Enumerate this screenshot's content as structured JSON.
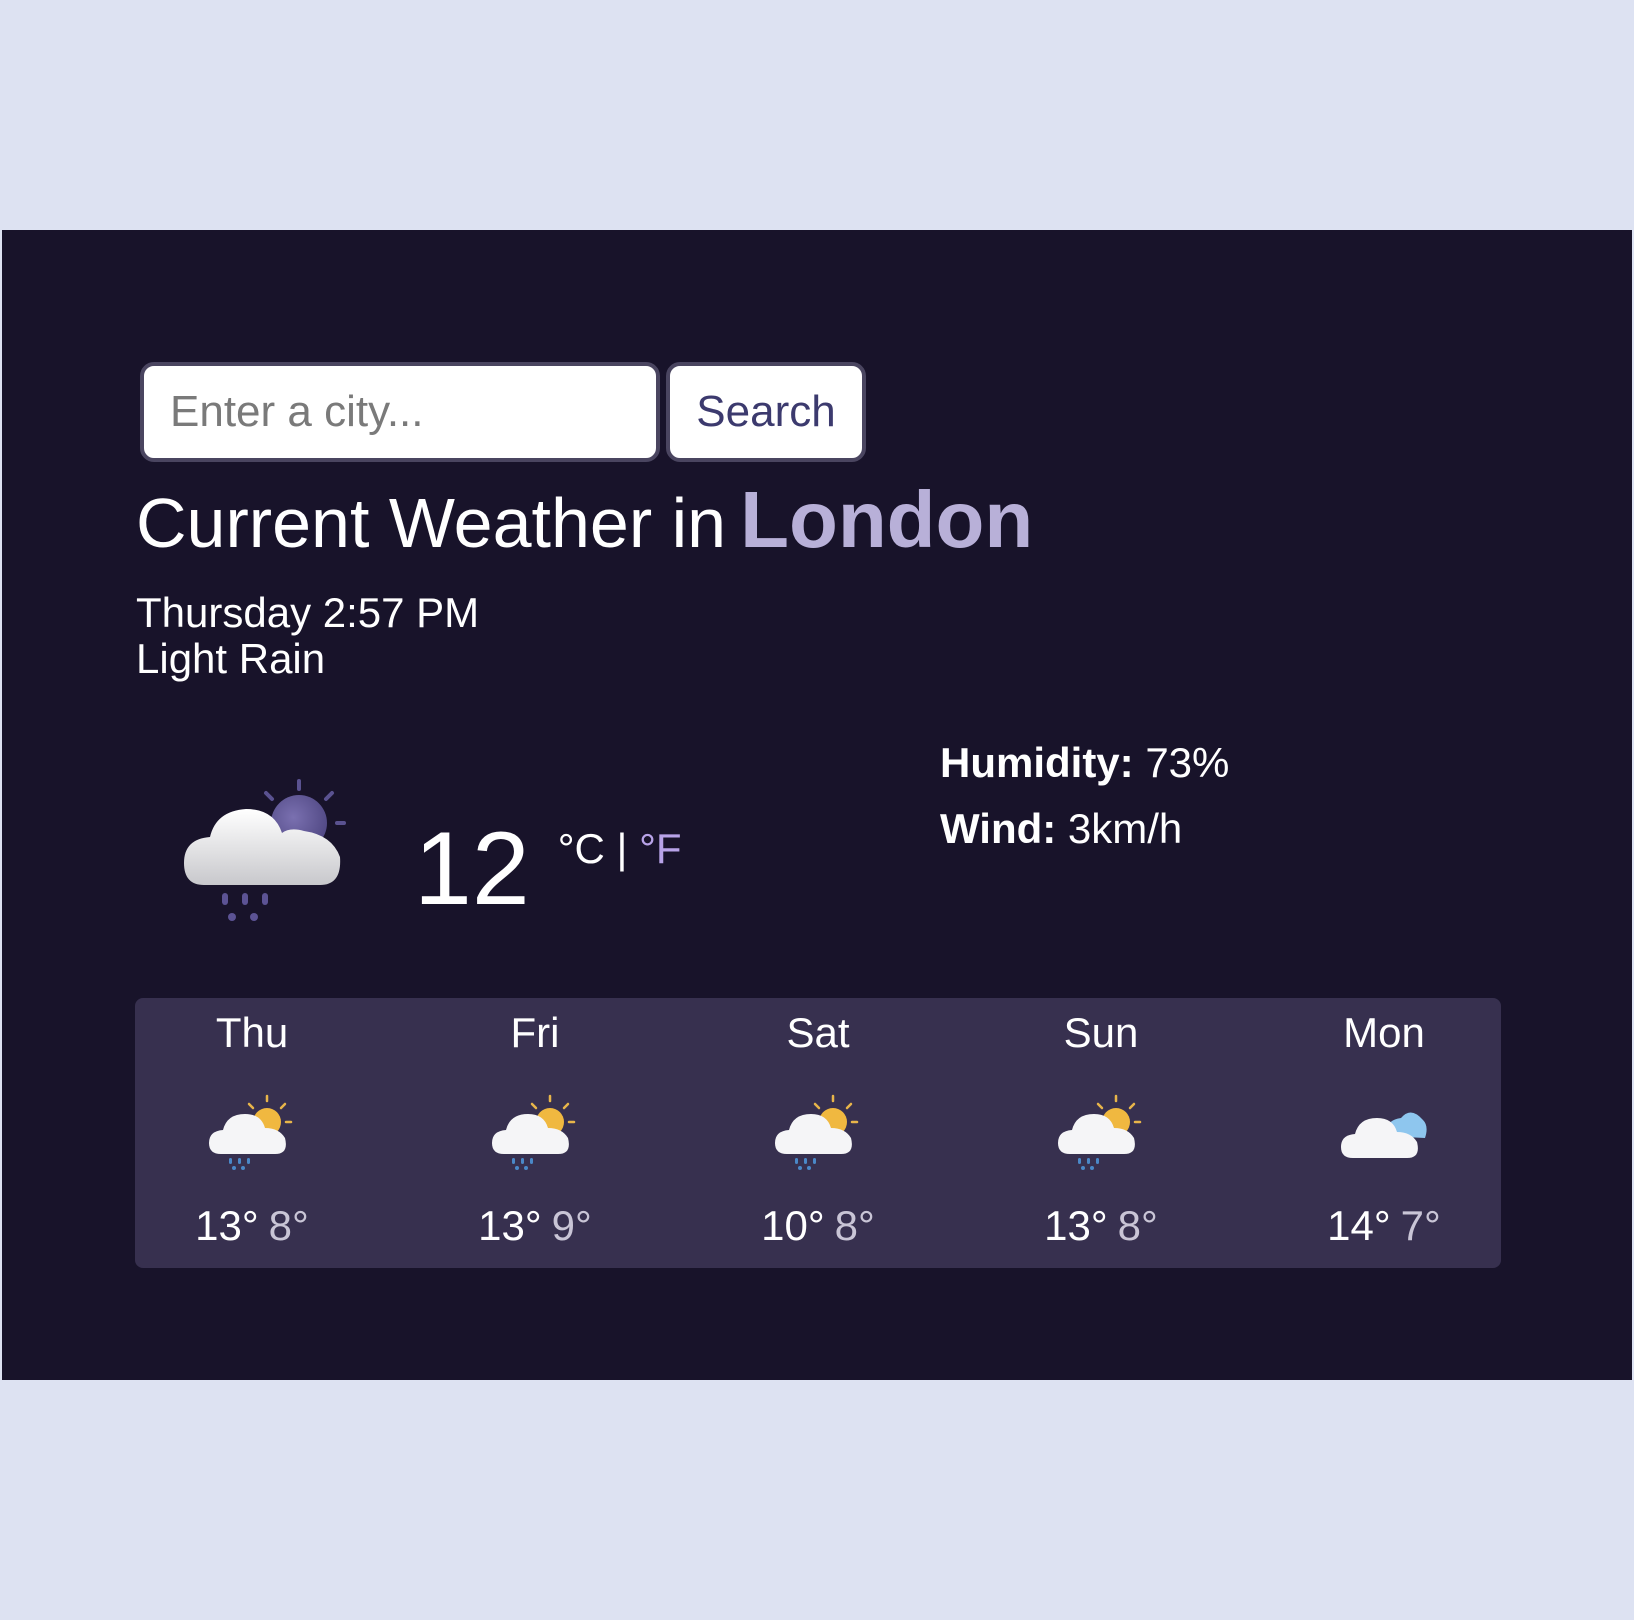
{
  "search": {
    "placeholder": "Enter a city...",
    "button_label": "Search"
  },
  "current": {
    "title_prefix": "Current Weather in",
    "city": "London",
    "datetime": "Thursday 2:57 PM",
    "condition": "Light Rain",
    "icon": "cloud-rain-night-icon",
    "temperature": "12",
    "unit_c": "°C",
    "unit_sep": "|",
    "unit_f": "°F",
    "humidity_label": "Humidity:",
    "humidity_value": "73%",
    "wind_label": "Wind:",
    "wind_value": "3km/h"
  },
  "forecast": [
    {
      "day": "Thu",
      "icon": "sun-cloud-rain-icon",
      "max": "13°",
      "min": "8°"
    },
    {
      "day": "Fri",
      "icon": "sun-cloud-rain-icon",
      "max": "13°",
      "min": "9°"
    },
    {
      "day": "Sat",
      "icon": "sun-cloud-rain-icon",
      "max": "10°",
      "min": "8°"
    },
    {
      "day": "Sun",
      "icon": "sun-cloud-rain-icon",
      "max": "13°",
      "min": "8°"
    },
    {
      "day": "Mon",
      "icon": "cloudy-icon",
      "max": "14°",
      "min": "7°"
    }
  ],
  "colors": {
    "page_bg": "#dde2f2",
    "app_bg": "#18132a",
    "forecast_bg": "#37304f",
    "city_accent": "#b8b0d8",
    "unit_accent": "#b8a3e8"
  }
}
